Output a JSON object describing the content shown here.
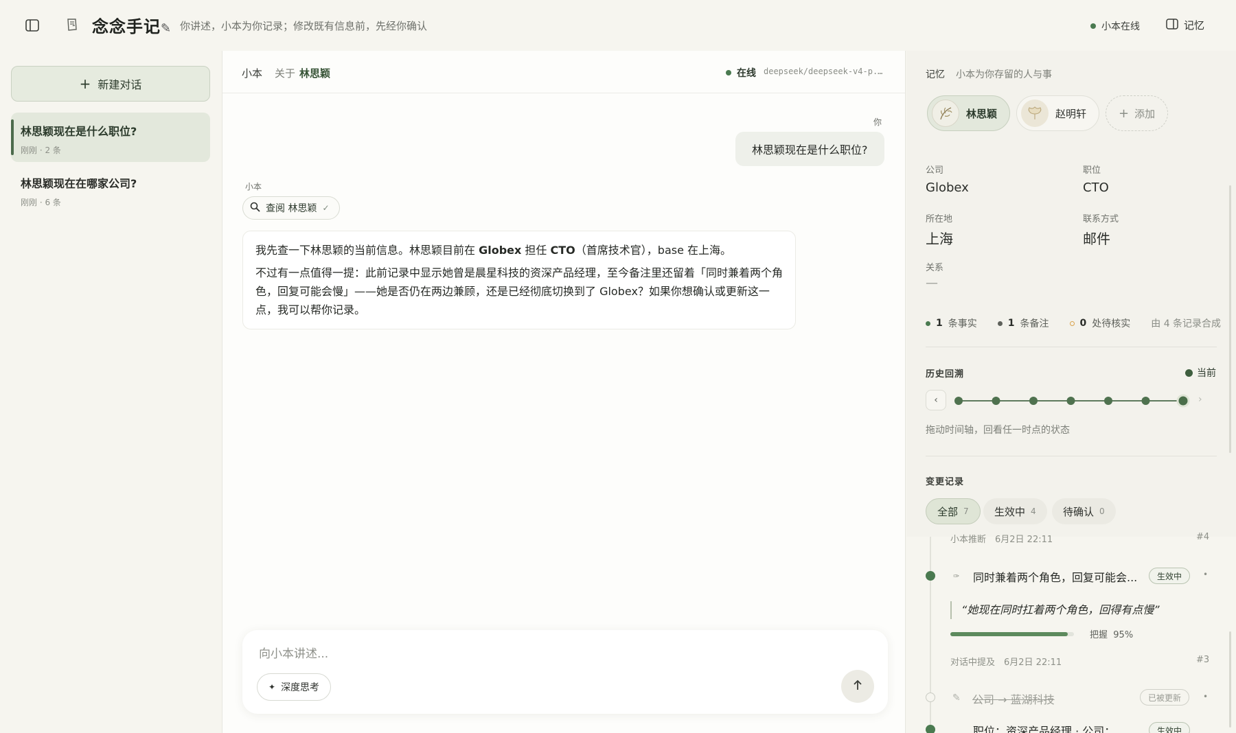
{
  "app": {
    "title": "念念手记",
    "title_icon": "pencil-icon",
    "subtitle": "你讲述，小本为你记录；修改既有信息前，先经你确认",
    "online_status": "小本在线",
    "memory_toggle_label": "记忆"
  },
  "sidebar": {
    "new_chat_label": "新建对话",
    "conversations": [
      {
        "title": "林思颖现在是什么职位?",
        "meta": "刚刚 · 2 条",
        "active": true
      },
      {
        "title": "林思颖现在在哪家公司?",
        "meta": "刚刚 · 6 条",
        "active": false
      }
    ]
  },
  "chat": {
    "header": {
      "assistant": "小本",
      "about_label": "关于",
      "person": "林思颖",
      "status": "在线",
      "model": "deepseek/deepseek-v4-p..."
    },
    "you_label": "你",
    "user_message": "林思颖现在是什么职位?",
    "assistant_label": "小本",
    "tool_call": {
      "label": "查阅 林思颖",
      "done": "✓"
    },
    "assistant_message": {
      "p1_a": "我先查一下林思颖的当前信息。林思颖目前在 ",
      "p1_company": "Globex",
      "p1_b": " 担任 ",
      "p1_title": "CTO",
      "p1_c": "（首席技术官），base 在上海。",
      "p2": "不过有一点值得一提：此前记录中显示她曾是晨星科技的资深产品经理，至今备注里还留着「同时兼着两个角色，回复可能会慢」——她是否仍在两边兼顾，还是已经彻底切换到了 Globex？如果你想确认或更新这一点，我可以帮你记录。"
    },
    "composer": {
      "placeholder": "向小本讲述...",
      "deep_think_label": "深度思考"
    }
  },
  "memory": {
    "title": "记忆",
    "subtitle": "小本为你存留的人与事",
    "people": [
      {
        "name": "林思颖",
        "active": true
      },
      {
        "name": "赵明轩",
        "active": false
      }
    ],
    "add_label": "添加",
    "fields": {
      "company_label": "公司",
      "company": "Globex",
      "title_label": "职位",
      "title": "CTO",
      "location_label": "所在地",
      "location": "上海",
      "contact_label": "联系方式",
      "contact": "邮件",
      "relation_label": "关系",
      "relation": "—"
    },
    "stats": {
      "facts_count": "1",
      "facts_label": "条事实",
      "notes_count": "1",
      "notes_label": "条备注",
      "pending_count": "0",
      "pending_label": "处待核实",
      "source": "由 4 条记录合成"
    },
    "history": {
      "label": "历史回溯",
      "current_label": "当前",
      "hint": "拖动时间轴，回看任一时点的状态",
      "points": 7,
      "current_index": 6
    },
    "changes": {
      "label": "变更记录",
      "filters": [
        {
          "label": "全部",
          "count": "7",
          "active": true
        },
        {
          "label": "生效中",
          "count": "4",
          "active": false
        },
        {
          "label": "待确认",
          "count": "0",
          "active": false
        }
      ],
      "events": [
        {
          "meta": "小本推断　6月2日 22:11",
          "num": "#4"
        },
        {
          "title": "同时兼着两个角色，回复可能会...",
          "badge": "生效中",
          "quote": "“她现在同时扛着两个角色，回得有点慢”",
          "confidence": 0.95,
          "confidence_label": "把握",
          "confidence_text": "95%",
          "meta": "对话中提及　6月2日 22:11",
          "num": "#3"
        },
        {
          "field": "公司",
          "arrow": "→",
          "value": "蓝湖科技",
          "badge": "已被更新"
        },
        {
          "title": "职位：资深产品经理 · 公司：...",
          "badge": "生效中"
        }
      ]
    },
    "colors": {
      "accent": "#4a7a50",
      "pending": "#d9a24a",
      "note": "#5e615b"
    }
  }
}
